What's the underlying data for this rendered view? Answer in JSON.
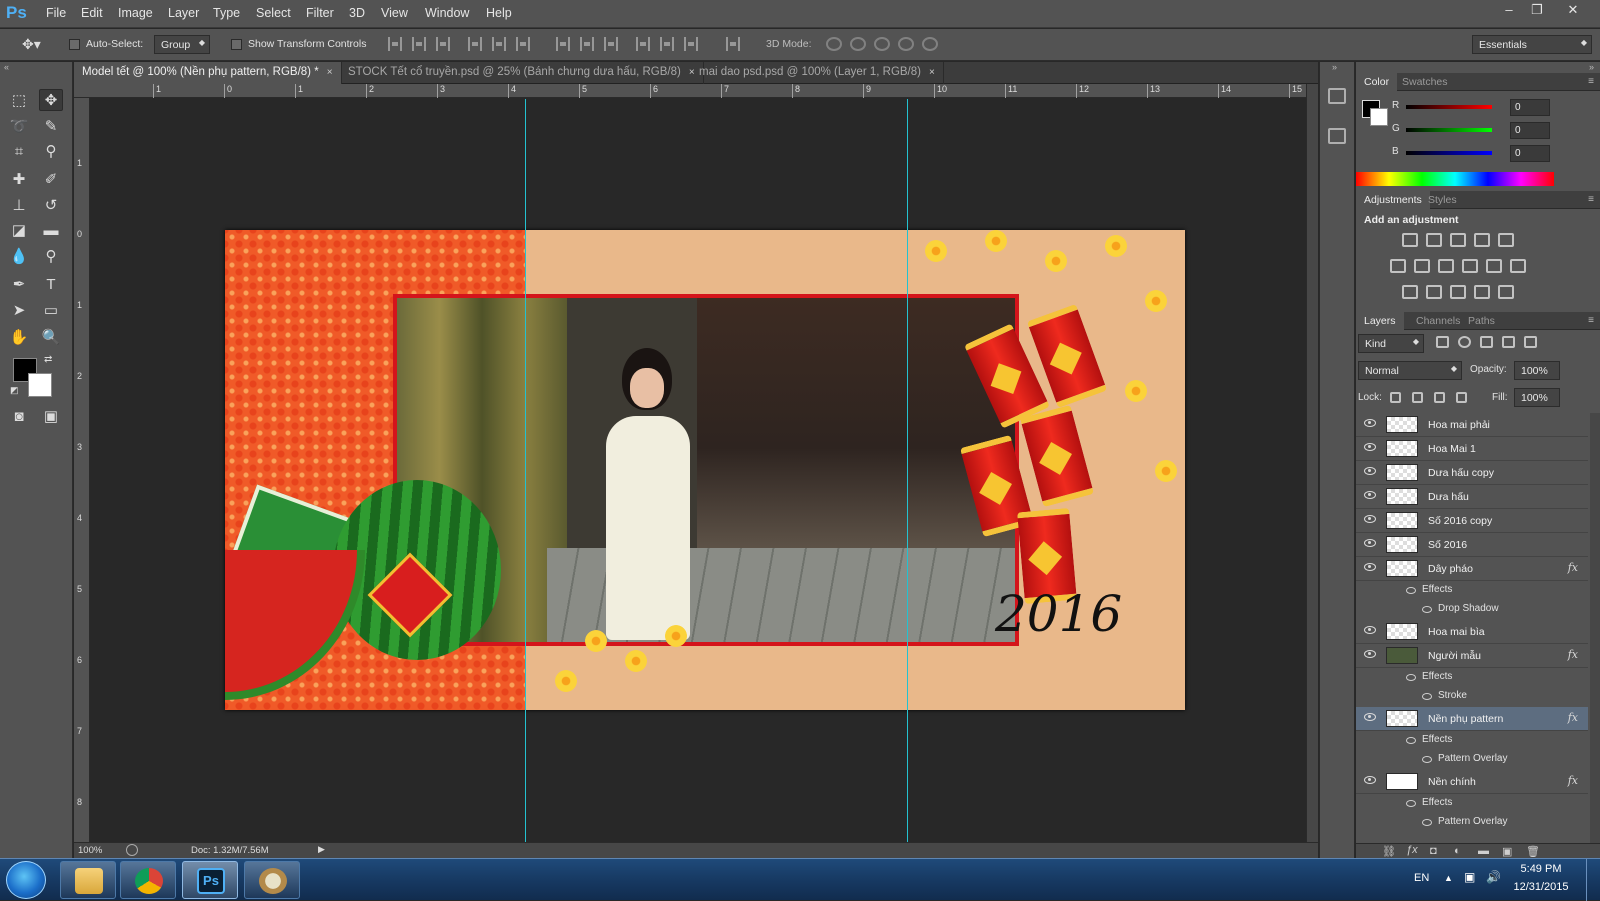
{
  "app": {
    "logo": "Ps"
  },
  "menu": [
    "File",
    "Edit",
    "Image",
    "Layer",
    "Type",
    "Select",
    "Filter",
    "3D",
    "View",
    "Window",
    "Help"
  ],
  "window_controls": {
    "minimize": "–",
    "restore": "❐",
    "close": "✕"
  },
  "options_bar": {
    "auto_select_label": "Auto-Select:",
    "auto_select_value": "Group",
    "show_transform_label": "Show Transform Controls",
    "mode3d_label": "3D Mode:",
    "workspace": "Essentials"
  },
  "doc_tabs": [
    {
      "label": "Model tết @ 100% (Nền phụ pattern, RGB/8) *",
      "active": true
    },
    {
      "label": "STOCK Tết cổ truyền.psd @ 25% (Bánh chưng dưa hấu, RGB/8)",
      "active": false
    },
    {
      "label": "mai dao psd.psd @ 100% (Layer 1, RGB/8)",
      "active": false
    }
  ],
  "tab_close": "×",
  "ruler_top": [
    "1",
    "0",
    "1",
    "2",
    "3",
    "4",
    "5",
    "6",
    "7",
    "8",
    "9",
    "10",
    "11",
    "12",
    "13",
    "14",
    "15"
  ],
  "ruler_left": [
    "1",
    "0",
    "1",
    "2",
    "3",
    "4",
    "5",
    "6",
    "7",
    "8"
  ],
  "canvas_art": {
    "year_text": "2016"
  },
  "status": {
    "zoom": "100%",
    "doc": "Doc: 1.32M/7.56M"
  },
  "color_panel": {
    "tabs": [
      "Color",
      "Swatches"
    ],
    "r_label": "R",
    "g_label": "G",
    "b_label": "B",
    "r": "0",
    "g": "0",
    "b": "0"
  },
  "adjustments_panel": {
    "tabs": [
      "Adjustments",
      "Styles"
    ],
    "heading": "Add an adjustment"
  },
  "layers_panel": {
    "tabs": [
      "Layers",
      "Channels",
      "Paths"
    ],
    "kind_label": "Kind",
    "blend_mode": "Normal",
    "opacity_label": "Opacity:",
    "opacity": "100%",
    "lock_label": "Lock:",
    "fill_label": "Fill:",
    "fill": "100%",
    "layers": [
      {
        "name": "Hoa mai phải",
        "fx": false,
        "effects": []
      },
      {
        "name": "Hoa Mai 1",
        "fx": false,
        "effects": []
      },
      {
        "name": "Dưa hấu copy",
        "fx": false,
        "effects": []
      },
      {
        "name": "Dưa hấu",
        "fx": false,
        "effects": []
      },
      {
        "name": "Số 2016 copy",
        "fx": false,
        "effects": []
      },
      {
        "name": "Số 2016",
        "fx": false,
        "effects": []
      },
      {
        "name": "Dây pháo",
        "fx": true,
        "effects": [
          "Effects",
          "Drop Shadow"
        ]
      },
      {
        "name": "Hoa mai bìa",
        "fx": false,
        "effects": []
      },
      {
        "name": "Người mẫu",
        "fx": true,
        "effects": [
          "Effects",
          "Stroke"
        ]
      },
      {
        "name": "Nền phụ pattern",
        "fx": true,
        "selected": true,
        "effects": [
          "Effects",
          "Pattern Overlay"
        ]
      },
      {
        "name": "Nền chính",
        "fx": true,
        "effects": [
          "Effects",
          "Pattern Overlay"
        ]
      }
    ],
    "fx_label": "fx"
  },
  "taskbar": {
    "lang": "EN",
    "time": "5:49 PM",
    "date": "12/31/2015"
  },
  "colors": {
    "accent_guide": "#24c2d0",
    "selected_layer": "#5d6d80",
    "frame_red": "#d4141b"
  }
}
